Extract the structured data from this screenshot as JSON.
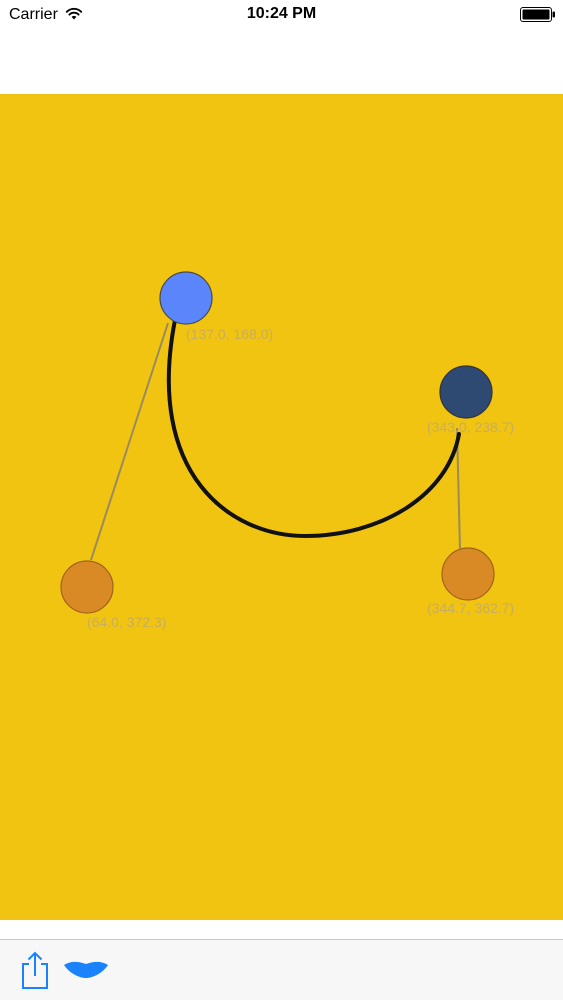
{
  "status_bar": {
    "carrier": "Carrier",
    "time": "10:24 PM",
    "icons": [
      "wifi-icon",
      "battery-icon"
    ]
  },
  "canvas": {
    "background_color": "#f0c410",
    "curve_color": "#111111",
    "guide_line_color": "#9a8a5e",
    "points": [
      {
        "role": "start",
        "label": "(137.0, 168.0)",
        "color": "#5b86fb"
      },
      {
        "role": "control1",
        "label": "(64.0, 372.3)",
        "color": "#d98a24"
      },
      {
        "role": "control2",
        "label": "(344.7, 362.7)",
        "color": "#d98a24"
      },
      {
        "role": "end",
        "label": "(343.0, 238.7)",
        "color": "#2e4a73"
      }
    ]
  },
  "toolbar": {
    "accent_color": "#1a82fb",
    "icons": [
      "share-icon",
      "curve-shape-icon"
    ]
  }
}
